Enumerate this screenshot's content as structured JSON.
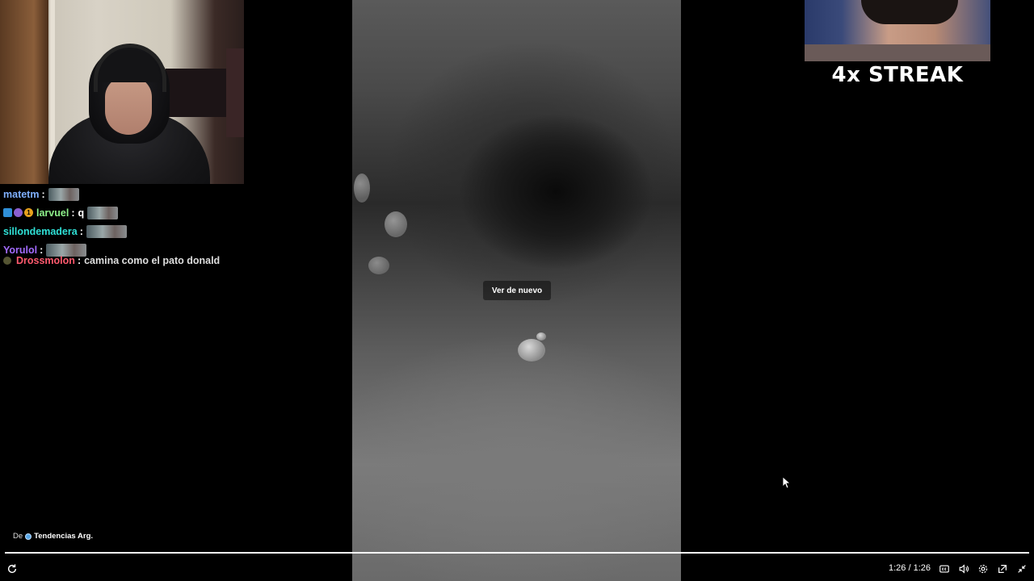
{
  "chat": {
    "messages": [
      {
        "user": "matetm",
        "color": "#7fb0ff",
        "sep": ":",
        "text": "",
        "emote": "emote"
      },
      {
        "user": "larvuel",
        "color": "#8ef08a",
        "sep": ":",
        "text": "q",
        "emote": "emote",
        "badges": [
          "badge-blue",
          "badge-purple",
          "badge-gold-1"
        ]
      },
      {
        "user": "sillondemadera",
        "color": "#2fe0d6",
        "sep": ":",
        "text": "",
        "emote": "emote"
      },
      {
        "user": "Yorulol",
        "color": "#a36bff",
        "sep": ":",
        "text": "",
        "emote": "emote"
      },
      {
        "user": "Drossmolon",
        "color": "#ff5a6e",
        "sep": ":",
        "text": "camina como el pato donald"
      }
    ],
    "badge_texts": [
      "",
      "",
      "1"
    ]
  },
  "video": {
    "replay_label": "Ver de nuevo"
  },
  "streak": {
    "label": "4x STREAK"
  },
  "source": {
    "prefix": "De",
    "channel": "Tendencias Arg."
  },
  "player": {
    "time": "1:26 / 1:26",
    "progress": 1.0,
    "icons": [
      "reload-icon",
      "captions-icon",
      "volume-icon",
      "settings-icon",
      "popout-icon",
      "exit-fullscreen-icon"
    ]
  }
}
